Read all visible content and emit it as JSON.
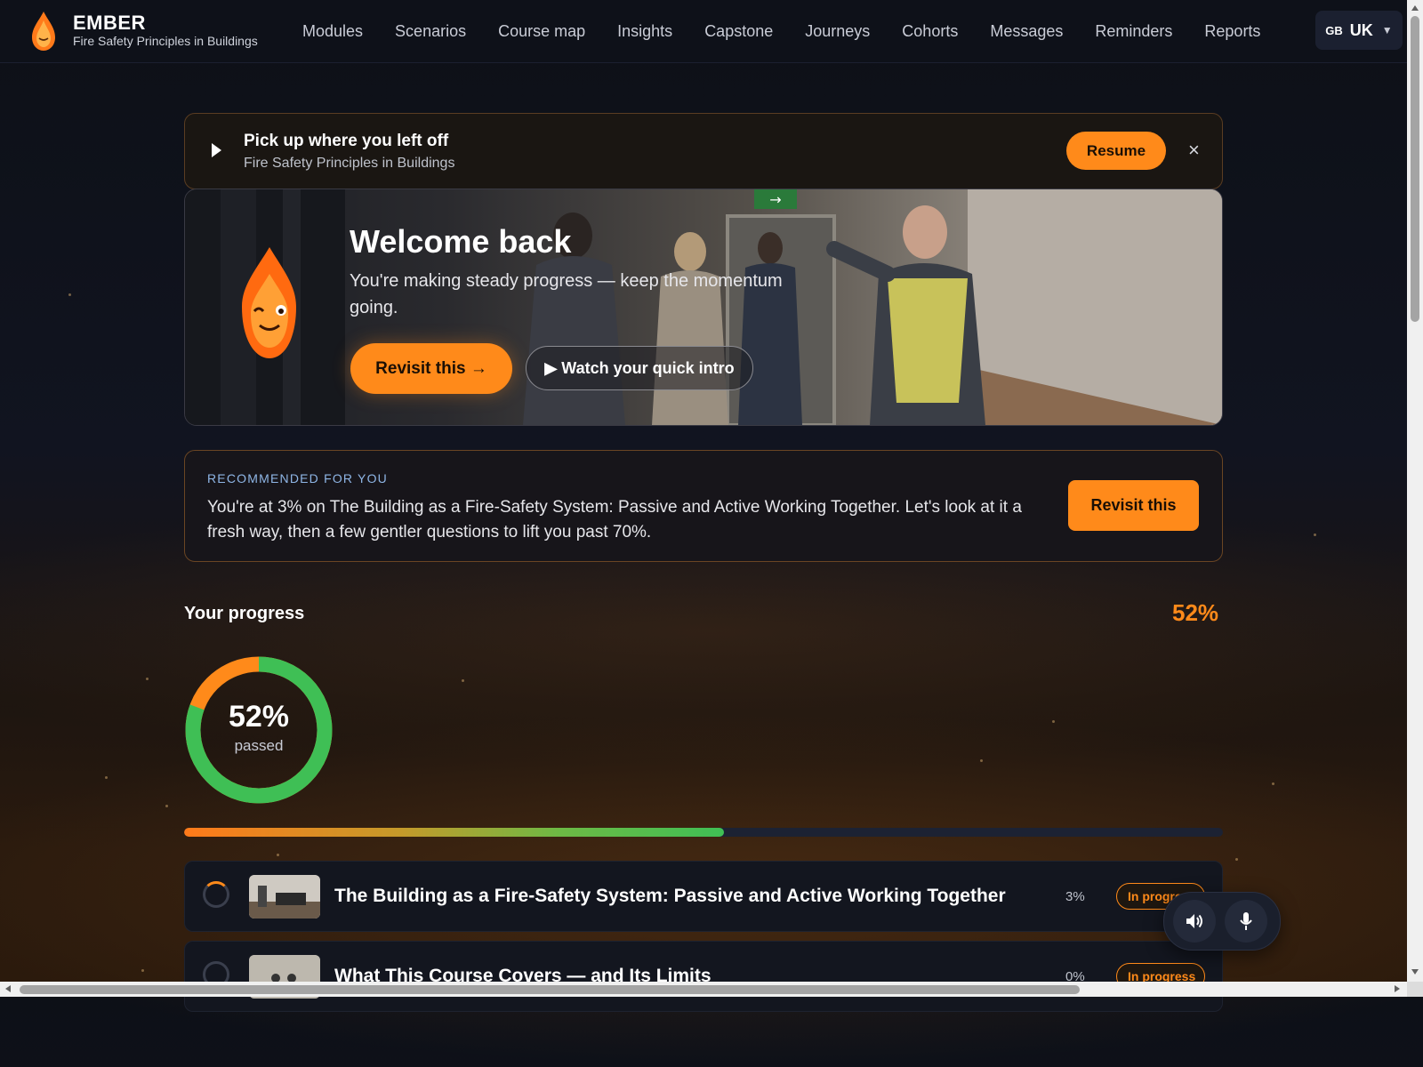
{
  "brand": {
    "name": "EMBER",
    "subtitle": "Fire Safety Principles in Buildings"
  },
  "nav": [
    "Modules",
    "Scenarios",
    "Course map",
    "Insights",
    "Capstone",
    "Journeys",
    "Cohorts",
    "Messages",
    "Reminders",
    "Reports"
  ],
  "language": {
    "country_code": "GB",
    "label": "UK"
  },
  "resume_banner": {
    "title": "Pick up where you left off",
    "subtitle": "Fire Safety Principles in Buildings",
    "button": "Resume",
    "close": "×"
  },
  "hero": {
    "heading": "Welcome back",
    "message": "You're making steady progress — keep the momentum going.",
    "primary_button": "Revisit this →",
    "secondary_button": "Watch your quick intro"
  },
  "recommendation": {
    "label": "RECOMMENDED FOR YOU",
    "text": "You're at 3% on The Building as a Fire-Safety System: Passive and Active Working Together. Let's look at it a fresh way, then a few gentler questions to lift you past 70%.",
    "button": "Revisit this"
  },
  "progress": {
    "title": "Your progress",
    "percent_label": "52%",
    "ring_value": "52%",
    "ring_caption": "passed",
    "fraction": 0.52
  },
  "modules": [
    {
      "title": "The Building as a Fire-Safety System: Passive and Active Working Together",
      "percent": "3%",
      "status": "In progress"
    },
    {
      "title": "What This Course Covers — and Its Limits",
      "percent": "0%",
      "status": "In progress"
    }
  ],
  "colors": {
    "accent": "#ff8a1a",
    "success": "#3fbf55",
    "background": "#0e1119"
  },
  "icons": {
    "brand": "flame-icon",
    "mascot": "flame-mascot",
    "volume": "speaker-icon",
    "mic": "microphone-icon"
  }
}
